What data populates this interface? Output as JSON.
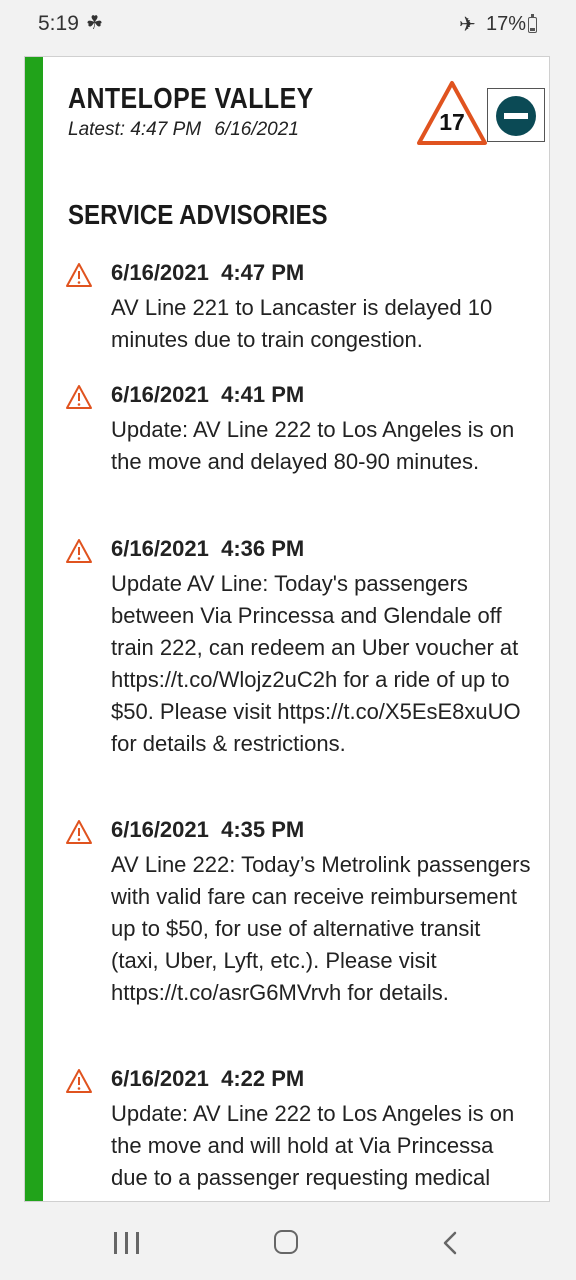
{
  "status_bar": {
    "time": "5:19",
    "battery": "17%",
    "notification_icon": "app-notification-icon",
    "airplane_icon": "airplane-mode-icon"
  },
  "header": {
    "title": "ANTELOPE VALLEY",
    "latest_label": "Latest: 4:47 PM",
    "latest_date": "6/16/2021",
    "alert_count": "17",
    "accent_color": "#21a31a",
    "alert_color": "#e0531f",
    "toggle_color": "#0b4a55"
  },
  "section": {
    "title": "SERVICE ADVISORIES"
  },
  "advisories": [
    {
      "timestamp": "6/16/2021  4:47 PM",
      "message": "AV Line 221 to Lancaster is delayed 10 minutes due to train congestion."
    },
    {
      "timestamp": "6/16/2021  4:41 PM",
      "message": "Update: AV Line 222 to Los Angeles is on the move and delayed 80-90 minutes."
    },
    {
      "timestamp": "6/16/2021  4:36 PM",
      "message": "Update AV Line: Today's passengers between Via Princessa and Glendale off train 222, can redeem an Uber voucher at https://t.co/Wlojz2uC2h for a ride of up to $50. Please visit https://t.co/X5EsE8xuUO for details & restrictions."
    },
    {
      "timestamp": "6/16/2021  4:35 PM",
      "message": "AV Line 222: Today’s Metrolink passengers with valid fare can receive reimbursement up to $50, for use of alternative transit (taxi, Uber, Lyft, etc.). Please visit https://t.co/asrG6MVrvh for details."
    },
    {
      "timestamp": "6/16/2021  4:22 PM",
      "message": "Update: AV Line 222 to Los Angeles is on the move and will hold at Via Princessa due to a passenger requesting medical attention."
    }
  ]
}
